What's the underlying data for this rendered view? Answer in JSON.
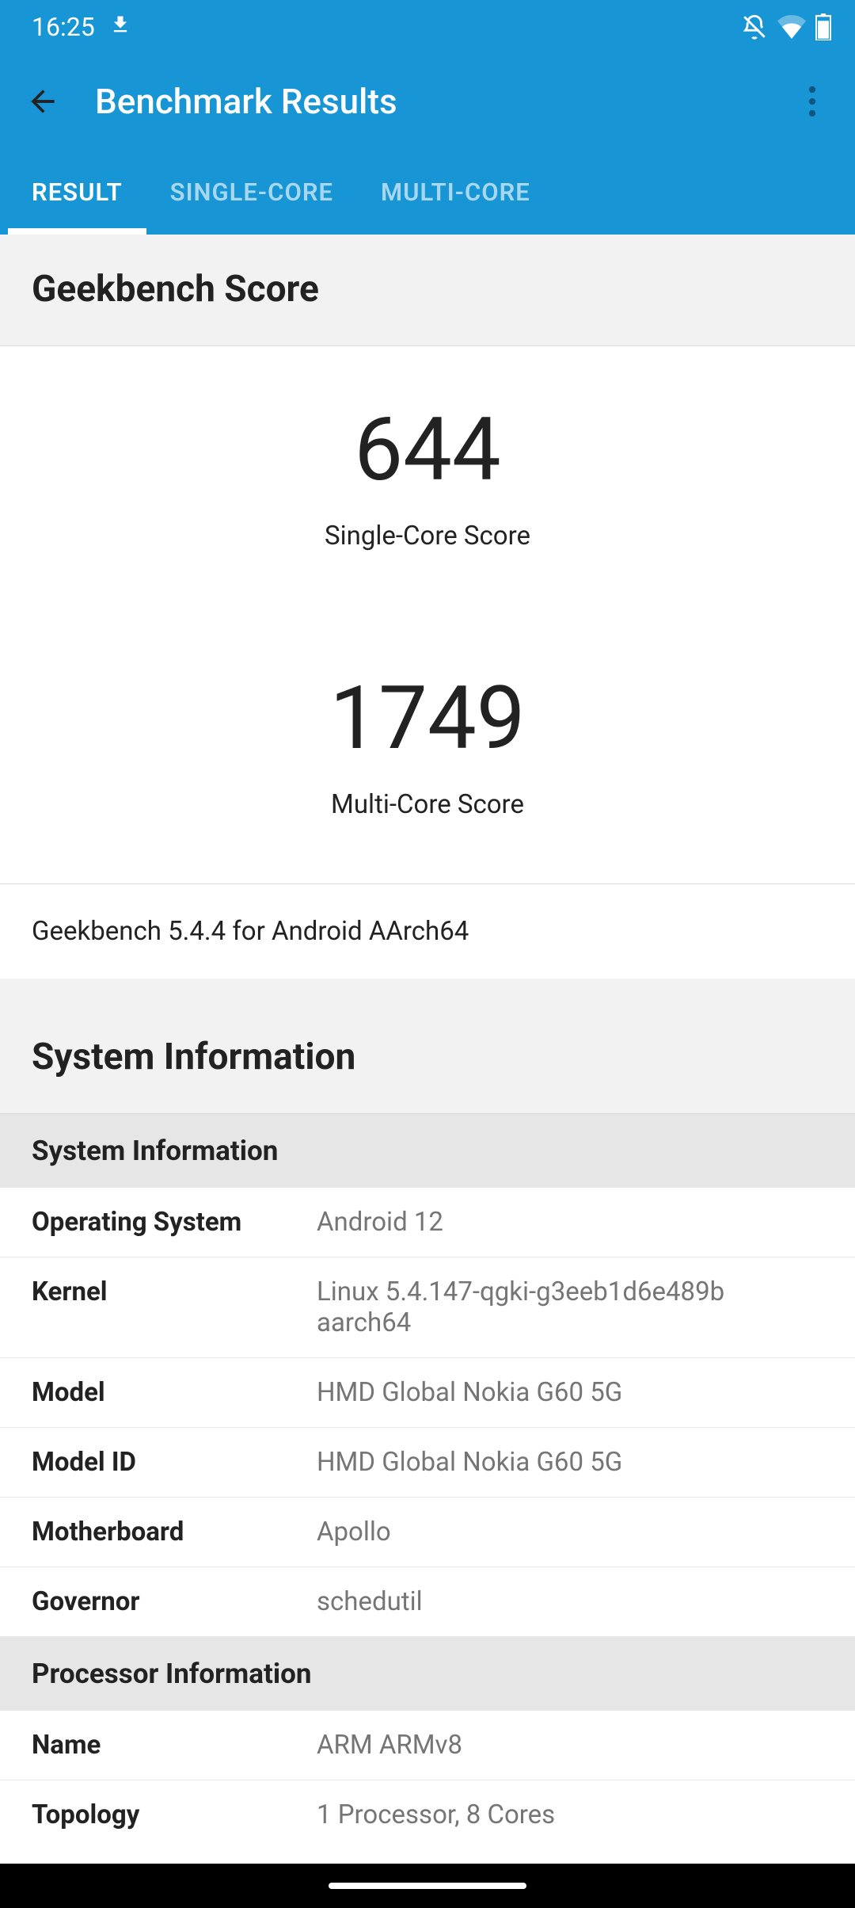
{
  "status": {
    "time": "16:25"
  },
  "header": {
    "title": "Benchmark Results"
  },
  "tabs": [
    {
      "label": "RESULT",
      "active": true
    },
    {
      "label": "SINGLE-CORE",
      "active": false
    },
    {
      "label": "MULTI-CORE",
      "active": false
    }
  ],
  "score_section": {
    "title": "Geekbench Score",
    "single_value": "644",
    "single_label": "Single-Core Score",
    "multi_value": "1749",
    "multi_label": "Multi-Core Score",
    "version": "Geekbench 5.4.4 for Android AArch64"
  },
  "sysinfo": {
    "title": "System Information",
    "sub1": "System Information",
    "rows1": [
      {
        "label": "Operating System",
        "value": "Android 12"
      },
      {
        "label": "Kernel",
        "value": "Linux 5.4.147-qgki-g3eeb1d6e489b aarch64"
      },
      {
        "label": "Model",
        "value": "HMD Global Nokia G60 5G"
      },
      {
        "label": "Model ID",
        "value": "HMD Global Nokia G60 5G"
      },
      {
        "label": "Motherboard",
        "value": "Apollo"
      },
      {
        "label": "Governor",
        "value": "schedutil"
      }
    ],
    "sub2": "Processor Information",
    "rows2": [
      {
        "label": "Name",
        "value": "ARM ARMv8"
      },
      {
        "label": "Topology",
        "value": "1 Processor, 8 Cores"
      }
    ]
  }
}
